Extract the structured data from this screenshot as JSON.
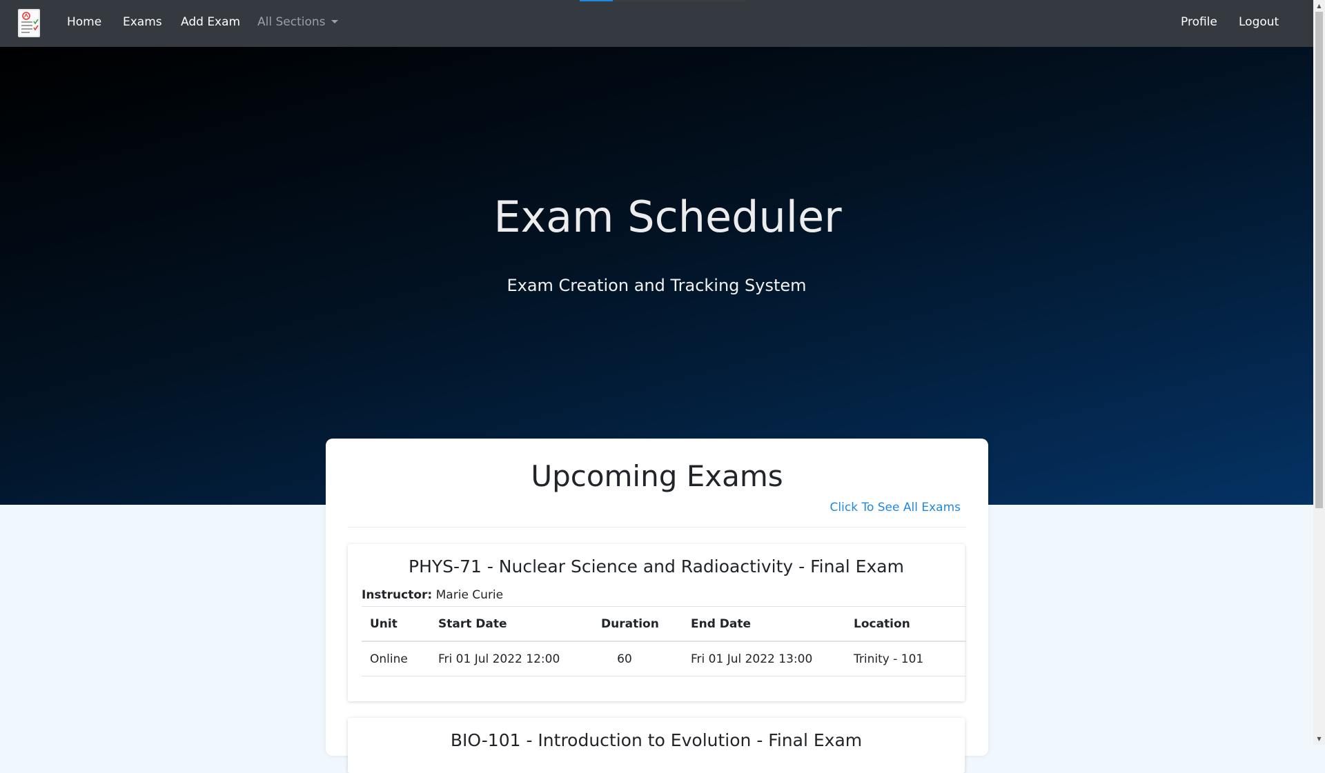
{
  "nav": {
    "links": {
      "home": "Home",
      "exams": "Exams",
      "add_exam": "Add Exam",
      "all_sections": "All Sections",
      "profile": "Profile",
      "logout": "Logout"
    },
    "load_progress": 0.2
  },
  "hero": {
    "title": "Exam Scheduler",
    "subtitle": "Exam Creation and Tracking System"
  },
  "upcoming": {
    "heading": "Upcoming Exams",
    "see_all_link": "Click To See All Exams",
    "instructor_label": "Instructor:",
    "columns": {
      "unit": "Unit",
      "start_date": "Start Date",
      "duration": "Duration",
      "end_date": "End Date",
      "location": "Location"
    },
    "exams": [
      {
        "title": "PHYS-71 - Nuclear Science and Radioactivity - Final Exam",
        "instructor": "Marie Curie",
        "unit": "Online",
        "start_date": "Fri 01 Jul 2022 12:00",
        "duration": "60",
        "end_date": "Fri 01 Jul 2022 13:00",
        "location": "Trinity - 101"
      },
      {
        "title": "BIO-101 - Introduction to Evolution - Final Exam"
      }
    ]
  },
  "colors": {
    "navbar": "#343a40",
    "link_accent": "#1e88e5",
    "page_background": "#f1f8fd"
  },
  "icons": {
    "brand": "exam-document-logo-icon",
    "dropdown": "caret-down-icon",
    "scroll_up": "arrow-up-icon",
    "scroll_down": "arrow-down-icon"
  }
}
